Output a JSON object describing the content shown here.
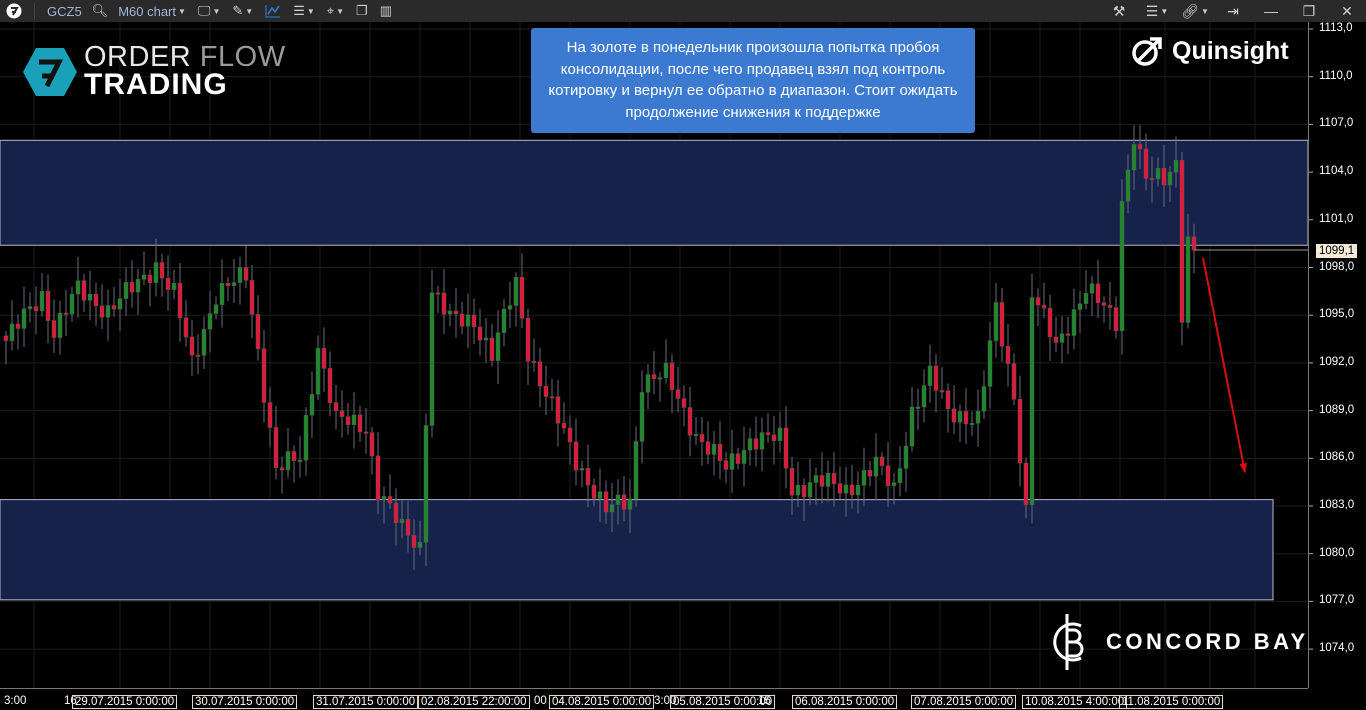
{
  "toolbar": {
    "symbol": "GCZ5",
    "chart_type": "M60 chart"
  },
  "note": "На золоте в понедельник произошла попытка пробоя консолидации, после чего продавец взял под контроль котировку и вернул ее обратно в диапазон. Стоит ожидать продолжение снижения к поддержке",
  "logos": {
    "order_flow_1": "ORDER ",
    "order_flow_2": "FLOW",
    "order_flow_3": "TRADING",
    "quinsight": "Quinsight",
    "concord": "CONCORD BAY"
  },
  "colors": {
    "up": "#1f8a2c",
    "down": "#e3193a",
    "zone": "#16224a",
    "note": "#3c7ad2",
    "arrow": "#d41010"
  },
  "chart_data": {
    "type": "candlestick",
    "symbol": "GCZ5",
    "timeframe": "M60",
    "ylim": [
      1071.1,
      1114.0
    ],
    "yticks": [
      1113.0,
      1110.0,
      1107.0,
      1104.0,
      1101.0,
      1098.0,
      1095.0,
      1092.0,
      1089.0,
      1086.0,
      1083.0,
      1080.0,
      1077.0,
      1074.0
    ],
    "ytick_labels": [
      "1113,0",
      "1110,0",
      "1107,0",
      "1104,0",
      "1101,0",
      "1098,0",
      "1095,0",
      "1092,0",
      "1089,0",
      "1086,0",
      "1083,0",
      "1080,0",
      "1077,0",
      "1074,0"
    ],
    "last_price": "1099,1",
    "bars": 199,
    "price_path": [
      [
        0,
        1093.4
      ],
      [
        6,
        1096.3
      ],
      [
        8,
        1094
      ],
      [
        12,
        1096.6
      ],
      [
        17,
        1095.3
      ],
      [
        22,
        1097
      ],
      [
        25,
        1098.2
      ],
      [
        28,
        1096.3
      ],
      [
        31,
        1092
      ],
      [
        35,
        1096.3
      ],
      [
        40,
        1097.5
      ],
      [
        42,
        1092.8
      ],
      [
        45,
        1085.3
      ],
      [
        49,
        1086
      ],
      [
        52,
        1093.1
      ],
      [
        55,
        1088.4
      ],
      [
        60,
        1088
      ],
      [
        62,
        1084
      ],
      [
        66,
        1081.5
      ],
      [
        69,
        1080.5
      ],
      [
        70,
        1088.7
      ],
      [
        71,
        1096.6
      ],
      [
        74,
        1094.7
      ],
      [
        78,
        1094.7
      ],
      [
        81,
        1092.5
      ],
      [
        85,
        1097
      ],
      [
        87,
        1092.8
      ],
      [
        90,
        1090
      ],
      [
        95,
        1085.9
      ],
      [
        100,
        1082.7
      ],
      [
        104,
        1083.4
      ],
      [
        106,
        1090.9
      ],
      [
        110,
        1091.2
      ],
      [
        115,
        1087.5
      ],
      [
        120,
        1085.3
      ],
      [
        124,
        1087.2
      ],
      [
        129,
        1087.2
      ],
      [
        131,
        1084
      ],
      [
        135,
        1084.6
      ],
      [
        140,
        1084
      ],
      [
        145,
        1085.6
      ],
      [
        148,
        1084
      ],
      [
        151,
        1089
      ],
      [
        154,
        1091.2
      ],
      [
        157,
        1089
      ],
      [
        162,
        1088.4
      ],
      [
        165,
        1095.3
      ],
      [
        168,
        1090
      ],
      [
        170,
        1082.7
      ],
      [
        171,
        1096.3
      ],
      [
        175,
        1093.1
      ],
      [
        180,
        1096.6
      ],
      [
        185,
        1094.7
      ],
      [
        186,
        1102.2
      ],
      [
        188,
        1106.3
      ],
      [
        190,
        1103.5
      ],
      [
        193,
        1103.6
      ],
      [
        195,
        1104.7
      ],
      [
        196,
        1095.3
      ],
      [
        197,
        1099.7
      ],
      [
        198,
        1099.1
      ]
    ],
    "zones": [
      {
        "name": "resistance",
        "from": 1099.4,
        "to": 1106.0
      },
      {
        "name": "support",
        "from": 1077.1,
        "to": 1083.4
      }
    ],
    "arrow": {
      "from_bar": 199.5,
      "from_price": 1098.6,
      "to_bar": 206.5,
      "to_price": 1085.1
    },
    "x_labels": [
      "3:00",
      "16",
      "29.07.2015 0:00:00",
      "30.07.2015 0:00:00",
      "31.07.2015 0:00:00",
      "02.08.2015 22:00:00",
      "00",
      "04.08.2015 0:00:00",
      "3:00",
      "05.08.2015 0:00:00",
      "15",
      "06.08.2015 0:00:00",
      "07.08.2015 0:00:00",
      "10.08.2015 4:00:00",
      "11.08.2015 0:00:00"
    ]
  }
}
